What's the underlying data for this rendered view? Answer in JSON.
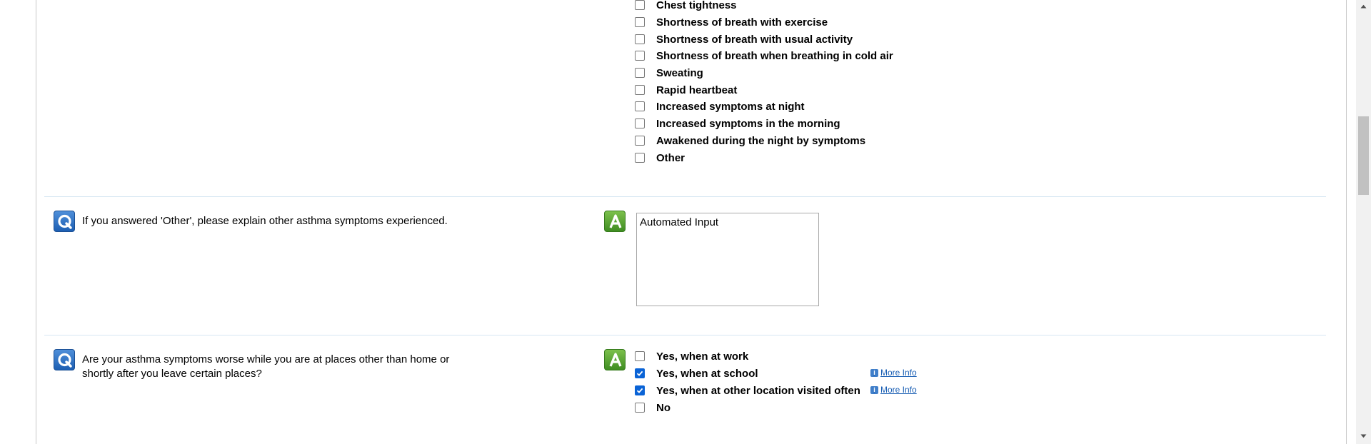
{
  "symptoms": [
    {
      "label": "Chest tightness",
      "checked": false
    },
    {
      "label": "Shortness of breath with exercise",
      "checked": false
    },
    {
      "label": "Shortness of breath with usual activity",
      "checked": false
    },
    {
      "label": "Shortness of breath when breathing in cold air",
      "checked": false
    },
    {
      "label": "Sweating",
      "checked": false
    },
    {
      "label": "Rapid heartbeat",
      "checked": false
    },
    {
      "label": "Increased symptoms at night",
      "checked": false
    },
    {
      "label": "Increased symptoms in the morning",
      "checked": false
    },
    {
      "label": "Awakened during the night by symptoms",
      "checked": false
    },
    {
      "label": "Other",
      "checked": false
    }
  ],
  "q_other": {
    "question": "If you answered 'Other', please explain other asthma symptoms experienced.",
    "answer_value": "Automated Input"
  },
  "q_places": {
    "question": "Are your asthma symptoms worse while you are at places other than home or shortly after you leave certain places?",
    "options": [
      {
        "label": "Yes, when at work",
        "checked": false
      },
      {
        "label": "Yes, when at school",
        "checked": true,
        "more_info": "More Info"
      },
      {
        "label": "Yes, when at other location visited often",
        "checked": true,
        "more_info": "More Info"
      },
      {
        "label": "No",
        "checked": false
      }
    ]
  },
  "icons": {
    "question": "Q",
    "answer": "A",
    "info": "i"
  }
}
